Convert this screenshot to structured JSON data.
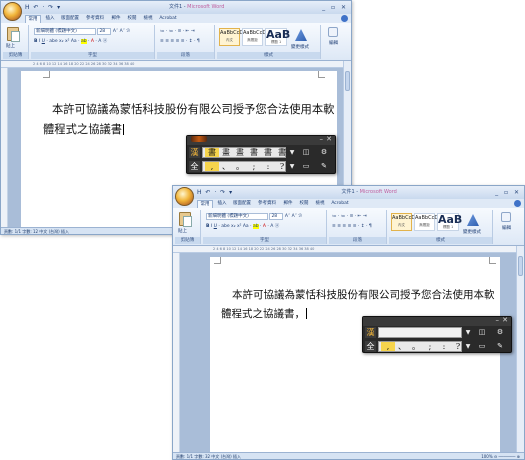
{
  "window_back": {
    "title": "文件1",
    "app": "Microsoft Word",
    "qat": "H ↶ · ↷ ▾",
    "tabs": [
      "常用",
      "插入",
      "版面配置",
      "參考資料",
      "郵件",
      "校閱",
      "檢視",
      "Acrobat"
    ],
    "ribbon": {
      "paste_label": "貼上",
      "clipboard_label": "剪貼簿",
      "font_name": "新細明體 (標題中文)",
      "font_size": "28",
      "font_group_label": "字型",
      "paragraph_group_label": "段落",
      "styles": [
        {
          "sample": "AaBbCcD",
          "name": "內文"
        },
        {
          "sample": "AaBbCcD",
          "name": "無間距"
        },
        {
          "sample": "AaB",
          "name": "標題 1"
        }
      ],
      "change_styles_label": "變更樣式",
      "styles_group_label": "樣式",
      "edit_label": "編輯"
    },
    "ruler": "2  4  6  8  10  12  14  16  18  20  22  24  26  28  30  32  34  36  38  40",
    "doc_line1": "本許可協議為蒙恬科技股份有限公司授予您合法使用本軟",
    "doc_line2": "體程式之協議書",
    "ime": {
      "candidates": [
        "書",
        "畫",
        "晝",
        "書",
        "書",
        "書"
      ],
      "symbols": [
        ",",
        "、",
        "。",
        ";",
        ":",
        "?"
      ],
      "btn_book": "◫",
      "btn_settings": "⚙",
      "btn_dict": "▭",
      "btn_wrench": "✎",
      "full": "全",
      "lang": "漢"
    }
  },
  "window_front": {
    "title": "文件1",
    "app": "Microsoft Word",
    "qat": "H ↶ · ↷ ▾",
    "tabs": [
      "常用",
      "插入",
      "版面配置",
      "參考資料",
      "郵件",
      "校閱",
      "檢視",
      "Acrobat"
    ],
    "ribbon": {
      "paste_label": "貼上",
      "clipboard_label": "剪貼簿",
      "font_name": "新細明體 (標題中文)",
      "font_size": "28",
      "font_group_label": "字型",
      "paragraph_group_label": "段落",
      "styles": [
        {
          "sample": "AaBbCcD",
          "name": "內文"
        },
        {
          "sample": "AaBbCcD",
          "name": "無間距"
        },
        {
          "sample": "AaB",
          "name": "標題 1"
        }
      ],
      "change_styles_label": "變更樣式",
      "styles_group_label": "樣式",
      "edit_label": "編輯"
    },
    "ruler": "2  4  6  8  10  12  14  16  18  20  22  24  26  28  30  32  34  36  38  40",
    "doc_line1": "本許可協議為蒙恬科技股份有限公司授予您合法使用本軟",
    "doc_line2": "體程式之協議書，",
    "ime": {
      "symbols": [
        ",",
        "、",
        "。",
        ";",
        ":",
        "?"
      ],
      "btn_book": "◫",
      "btn_settings": "⚙",
      "btn_dict": "▭",
      "btn_wrench": "✎",
      "full": "全",
      "lang": "漢"
    },
    "status_left": "頁數: 1/1    字數: 32    中文 (台灣)    插入",
    "status_right": "100%  ⊖ ─────── ⊕"
  },
  "status_back": "頁數: 1/1    字數: 12    中文 (台灣)    插入"
}
